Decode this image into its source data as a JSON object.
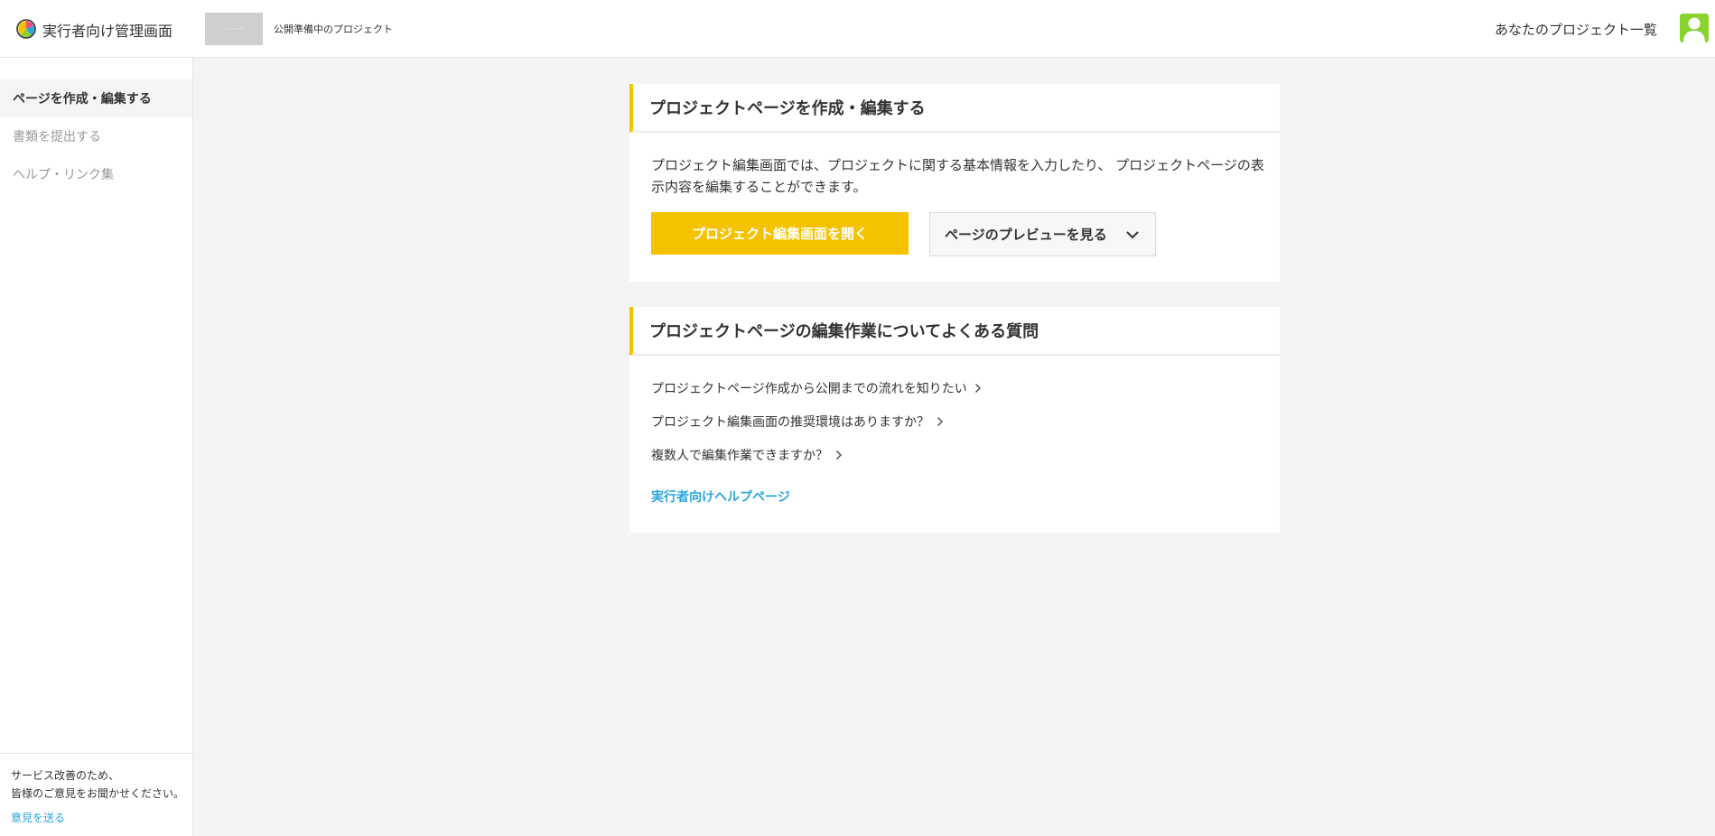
{
  "header": {
    "app_title": "実行者向け管理画面",
    "project_name": "公開準備中のプロジェクト",
    "projects_link": "あなたのプロジェクト一覧",
    "avatar_color": "#8ad22f"
  },
  "sidebar": {
    "items": [
      {
        "label": "ページを作成・編集する",
        "active": true
      },
      {
        "label": "書類を提出する",
        "active": false
      },
      {
        "label": "ヘルプ・リンク集",
        "active": false
      }
    ],
    "feedback_line1": "サービス改善のため、",
    "feedback_line2": "皆様のご意見をお聞かせください。",
    "feedback_link": "意見を送る"
  },
  "card_edit": {
    "title": "プロジェクトページを作成・編集する",
    "description": "プロジェクト編集画面では、プロジェクトに関する基本情報を入力したり、 プロジェクトページの表示内容を編集することができます。",
    "open_editor_label": "プロジェクト編集画面を開く",
    "preview_label": "ページのプレビューを見る"
  },
  "card_faq": {
    "title": "プロジェクトページの編集作業についてよくある質問",
    "questions": [
      "プロジェクトページ作成から公開までの流れを知りたい",
      "プロジェクト編集画面の推奨環境はありますか？",
      "複数人で編集作業できますか？"
    ],
    "help_link": "実行者向けヘルプページ"
  },
  "colors": {
    "accent": "#f5c200",
    "link": "#29a5e0"
  }
}
